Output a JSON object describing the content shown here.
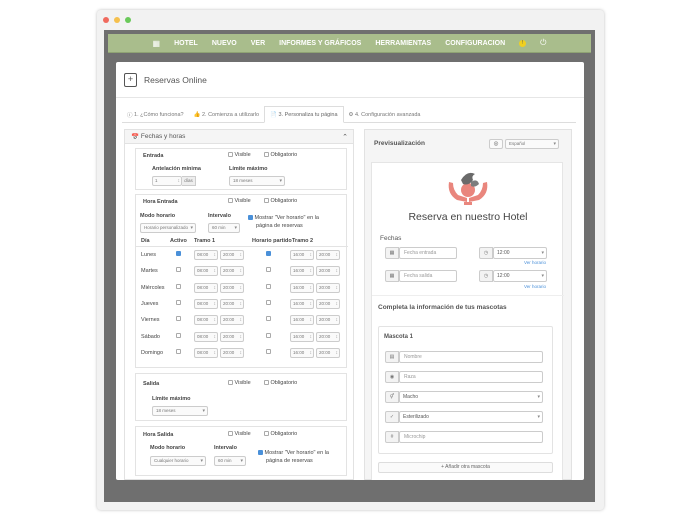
{
  "window": {
    "dots": [
      "#f06a5e",
      "#f5c04d",
      "#6ac95a"
    ]
  },
  "nav": {
    "items": [
      "HOTEL",
      "NUEVO",
      "VER",
      "INFORMES Y GRÁFICOS",
      "HERRAMIENTAS",
      "CONFIGURACION"
    ],
    "warn": "!",
    "bg": "#a9bd8c"
  },
  "header": {
    "title": "Reservas Online",
    "icon": "calendar-plus-icon"
  },
  "tabs": [
    "1. ¿Cómo funciona?",
    "2. Comienza a utilizarlo",
    "3. Personaliza tu página",
    "4. Configuración avanzada"
  ],
  "left": {
    "panel_title": "Fechas y horas",
    "entrada": {
      "title": "Entrada",
      "visible": "Visible",
      "obligatorio": "Obligatorio",
      "antelacion_label": "Antelación mínima",
      "antelacion_value": "1",
      "antelacion_unit": "días",
      "limite_label": "Límite máximo",
      "limite_value": "18 meses"
    },
    "hora_entrada": {
      "title": "Hora Entrada",
      "visible": "Visible",
      "obligatorio": "Obligatorio",
      "modo_label": "Modo horario",
      "modo_value": "Horario personalizado",
      "intervalo_label": "Intervalo",
      "intervalo_value": "60 min",
      "mostrar": "Mostrar \"Ver horario\" en la",
      "mostrar2": "página de reservas"
    },
    "table": {
      "headers": [
        "Día",
        "Activo",
        "Tramo 1",
        "Horario partido",
        "Tramo 2"
      ],
      "rows": [
        {
          "day": "Lunes",
          "active": true,
          "t1a": "08:00",
          "t1b": "20:00",
          "split": true,
          "t2a": "16:00",
          "t2b": "20:00"
        },
        {
          "day": "Martes",
          "active": false,
          "t1a": "08:00",
          "t1b": "20:00",
          "split": false,
          "t2a": "16:00",
          "t2b": "20:00"
        },
        {
          "day": "Miércoles",
          "active": false,
          "t1a": "08:00",
          "t1b": "20:00",
          "split": false,
          "t2a": "16:00",
          "t2b": "20:00"
        },
        {
          "day": "Jueves",
          "active": false,
          "t1a": "08:00",
          "t1b": "20:00",
          "split": false,
          "t2a": "16:00",
          "t2b": "20:00"
        },
        {
          "day": "Viernes",
          "active": false,
          "t1a": "08:00",
          "t1b": "20:00",
          "split": false,
          "t2a": "16:00",
          "t2b": "20:00"
        },
        {
          "day": "Sábado",
          "active": false,
          "t1a": "08:00",
          "t1b": "20:00",
          "split": false,
          "t2a": "16:00",
          "t2b": "20:00"
        },
        {
          "day": "Domingo",
          "active": false,
          "t1a": "08:00",
          "t1b": "20:00",
          "split": false,
          "t2a": "16:00",
          "t2b": "20:00"
        }
      ]
    },
    "salida": {
      "title": "Salida",
      "visible": "Visible",
      "obligatorio": "Obligatorio",
      "limite_label": "Límite máximo",
      "limite_value": "18 meses"
    },
    "hora_salida": {
      "title": "Hora Salida",
      "visible": "Visible",
      "obligatorio": "Obligatorio",
      "modo_label": "Modo horario",
      "modo_value": "Cualquier horario",
      "intervalo_label": "Intervalo",
      "intervalo_value": "60 min",
      "mostrar": "Mostrar \"Ver horario\" en la",
      "mostrar2": "página de reservas"
    }
  },
  "right": {
    "title": "Previsualización",
    "lang": "Español",
    "heading": "Reserva en nuestro Hotel",
    "fechas": "Fechas",
    "entrada_ph": "Fecha entrada",
    "entrada_time": "12:00",
    "salida_ph": "Fecha salida",
    "salida_time": "12:00",
    "ver_horario": "Ver horario",
    "mascotas_title": "Completa la información de tus mascotas",
    "mascota": "Mascota 1",
    "fields": [
      "Nombre",
      "Raza",
      "Macho",
      "Esterilizado",
      "Microchip"
    ],
    "add": "+ Añadir otra mascota"
  }
}
